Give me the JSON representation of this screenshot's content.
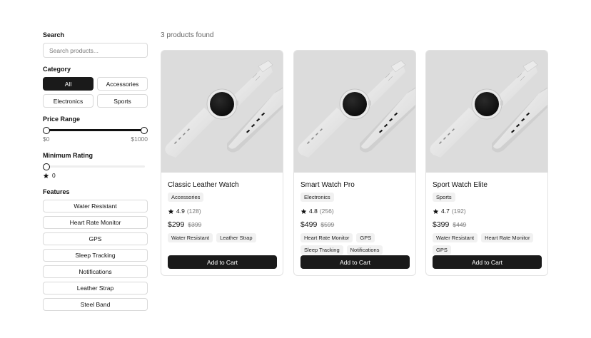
{
  "filters": {
    "search": {
      "label": "Search",
      "placeholder": "Search products..."
    },
    "category": {
      "label": "Category",
      "options": [
        "All",
        "Accessories",
        "Electronics",
        "Sports"
      ],
      "selected": "All"
    },
    "price": {
      "label": "Price Range",
      "min_label": "$0",
      "max_label": "$1000",
      "min": 0,
      "max": 1000
    },
    "rating": {
      "label": "Minimum Rating",
      "value": "0"
    },
    "features": {
      "label": "Features",
      "options": [
        "Water Resistant",
        "Heart Rate Monitor",
        "GPS",
        "Sleep Tracking",
        "Notifications",
        "Leather Strap",
        "Steel Band"
      ]
    }
  },
  "results": {
    "count_text": "3 products found"
  },
  "products": [
    {
      "name": "Classic Leather Watch",
      "category": "Accessories",
      "rating": "4.9",
      "reviews": "(128)",
      "price": "$299",
      "old_price": "$399",
      "features": [
        "Water Resistant",
        "Leather Strap"
      ],
      "button": "Add to Cart"
    },
    {
      "name": "Smart Watch Pro",
      "category": "Electronics",
      "rating": "4.8",
      "reviews": "(256)",
      "price": "$499",
      "old_price": "$599",
      "features": [
        "Heart Rate Monitor",
        "GPS",
        "Sleep Tracking",
        "Notifications"
      ],
      "button": "Add to Cart"
    },
    {
      "name": "Sport Watch Elite",
      "category": "Sports",
      "rating": "4.7",
      "reviews": "(192)",
      "price": "$399",
      "old_price": "$449",
      "features": [
        "Water Resistant",
        "Heart Rate Monitor",
        "GPS"
      ],
      "button": "Add to Cart"
    }
  ],
  "colors": {
    "accent": "#1a1a1a",
    "image_bg": "#dcdcdc",
    "border": "#e2e2e2"
  },
  "icons": {
    "rating": "star-icon",
    "product_image": "watch-image"
  }
}
